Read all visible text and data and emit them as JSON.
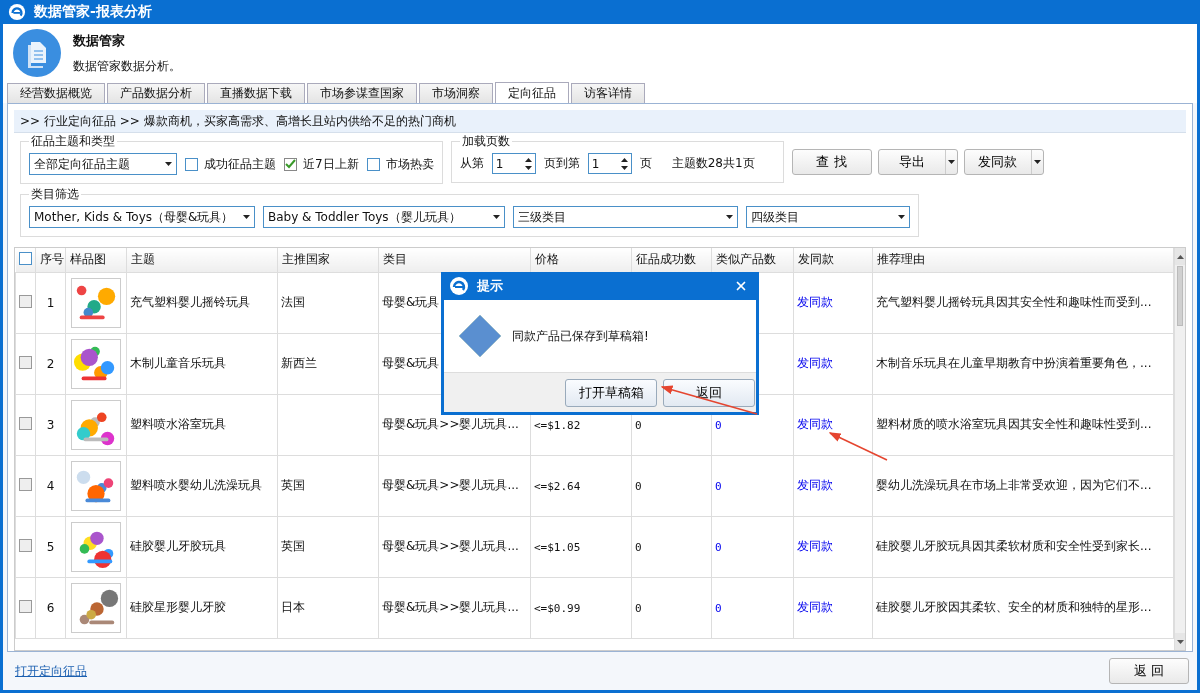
{
  "window": {
    "title": "数据管家-报表分析"
  },
  "header": {
    "title": "数据管家",
    "subtitle": "数据管家数据分析。"
  },
  "tabs": [
    {
      "label": "经营数据概览",
      "selected": false
    },
    {
      "label": "产品数据分析",
      "selected": false
    },
    {
      "label": "直播数据下载",
      "selected": false
    },
    {
      "label": "市场参谋查国家",
      "selected": false
    },
    {
      "label": "市场洞察",
      "selected": false
    },
    {
      "label": "定向征品",
      "selected": true
    },
    {
      "label": "访客详情",
      "selected": false
    }
  ],
  "breadcrumb": ">> 行业定向征品 >> 爆款商机，买家高需求、高增长且站内供给不足的热门商机",
  "theme_group": {
    "legend": "征品主题和类型",
    "select": "全部定向征品主题",
    "checkboxes": [
      {
        "label": "成功征品主题",
        "checked": false
      },
      {
        "label": "近7日上新",
        "checked": true
      },
      {
        "label": "市场热卖",
        "checked": false
      }
    ]
  },
  "pages_group": {
    "legend": "加载页数",
    "from_label": "从第",
    "from_value": "1",
    "to_label": "页到第",
    "to_value": "1",
    "page_label": "页",
    "summary": "主题数28共1页"
  },
  "buttons": [
    {
      "label": "查 找",
      "has_menu": false
    },
    {
      "label": "导出",
      "has_menu": true
    },
    {
      "label": "发同款",
      "has_menu": true
    }
  ],
  "category_group": {
    "legend": "类目筛选",
    "selects": [
      "Mother, Kids & Toys（母婴&玩具）",
      "Baby & Toddler Toys（婴儿玩具）",
      "三级类目",
      "四级类目"
    ]
  },
  "table": {
    "header_checked": false,
    "columns": [
      "序号",
      "样品图",
      "主题",
      "主推国家",
      "类目",
      "价格",
      "征品成功数",
      "类似产品数",
      "发同款",
      "推荐理由"
    ],
    "rows": [
      {
        "checked": false,
        "index": "1",
        "theme": "充气塑料婴儿摇铃玩具",
        "country": "法国",
        "category": "母婴&玩具",
        "action": "发同款",
        "reason": "充气塑料婴儿摇铃玩具因其安全性和趣味性而受到..."
      },
      {
        "checked": false,
        "index": "2",
        "theme": "木制儿童音乐玩具",
        "country": "新西兰",
        "category": "母婴&玩具",
        "action": "发同款",
        "reason": "木制音乐玩具在儿童早期教育中扮演着重要角色，..."
      },
      {
        "checked": false,
        "index": "3",
        "theme": "塑料喷水浴室玩具",
        "category": "母婴&玩具>>婴儿玩具...",
        "price": "<=$1.82",
        "success": "0",
        "similar": "0",
        "action": "发同款",
        "reason": "塑料材质的喷水浴室玩具因其安全性和趣味性受到..."
      },
      {
        "checked": false,
        "index": "4",
        "theme": "塑料喷水婴幼儿洗澡玩具",
        "country": "英国",
        "category": "母婴&玩具>>婴儿玩具...",
        "price": "<=$2.64",
        "success": "0",
        "similar": "0",
        "action": "发同款",
        "reason": "婴幼儿洗澡玩具在市场上非常受欢迎，因为它们不..."
      },
      {
        "checked": false,
        "index": "5",
        "theme": "硅胶婴儿牙胶玩具",
        "country": "英国",
        "category": "母婴&玩具>>婴儿玩具...",
        "price": "<=$1.05",
        "success": "0",
        "similar": "0",
        "action": "发同款",
        "reason": "硅胶婴儿牙胶玩具因其柔软材质和安全性受到家长..."
      },
      {
        "checked": false,
        "index": "6",
        "theme": "硅胶星形婴儿牙胶",
        "country": "日本",
        "category": "母婴&玩具>>婴儿玩具...",
        "price": "<=$0.99",
        "success": "0",
        "similar": "0",
        "action": "发同款",
        "reason": "硅胶婴儿牙胶因其柔软、安全的材质和独特的星形..."
      }
    ]
  },
  "dialog": {
    "title": "提示",
    "message": "同款产品已保存到草稿箱!",
    "buttons": [
      "打开草稿箱",
      "返回"
    ]
  },
  "footer": {
    "link": "打开定向征品",
    "button": "返 回"
  }
}
